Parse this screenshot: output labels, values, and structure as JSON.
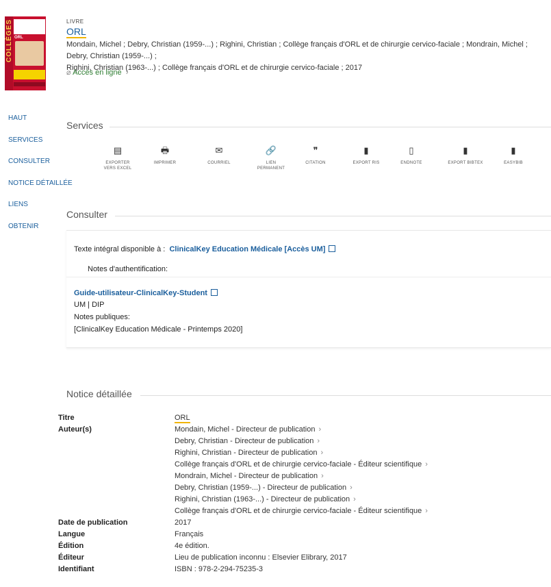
{
  "record": {
    "type": "LIVRE",
    "title": "ORL",
    "authors_line1": "Mondain, Michel ; Debry, Christian (1959-...) ; Righini, Christian ; Collège français d'ORL et de chirurgie cervico-faciale ; Mondrain, Michel ; Debry, Christian (1959-...) ;",
    "authors_line2": "Righini, Christian (1963-...) ; Collège français d'ORL et de chirurgie cervico-faciale ; 2017",
    "access": "Accès en ligne",
    "cover_text": "COLLÈGES",
    "cover_title": "ORL"
  },
  "nav": [
    "HAUT",
    "SERVICES",
    "CONSULTER",
    "NOTICE DÉTAILLÉE",
    "LIENS",
    "OBTENIR"
  ],
  "services": {
    "title": "Services",
    "items": [
      {
        "l1": "EXPORTER",
        "l2": "VERS EXCEL",
        "icon": "excel-icon",
        "glyph": "▤"
      },
      {
        "l1": "IMPRIMER",
        "l2": "",
        "icon": "print-icon",
        "glyph": "🖶"
      },
      {
        "l1": "COURRIEL",
        "l2": "",
        "icon": "mail-icon",
        "glyph": "✉"
      },
      {
        "l1": "LIEN",
        "l2": "PERMANENT",
        "icon": "link-icon",
        "glyph": "🔗"
      },
      {
        "l1": "CITATION",
        "l2": "",
        "icon": "quote-icon",
        "glyph": "❞"
      },
      {
        "l1": "EXPORT RIS",
        "l2": "",
        "icon": "file-icon",
        "glyph": "▮"
      },
      {
        "l1": "ENDNOTE",
        "l2": "",
        "icon": "file-outline-icon",
        "glyph": "▯"
      },
      {
        "l1": "EXPORT BIBTEX",
        "l2": "",
        "icon": "file-icon",
        "glyph": "▮"
      },
      {
        "l1": "EASYBIB",
        "l2": "",
        "icon": "file-icon",
        "glyph": "▮"
      }
    ]
  },
  "consulter": {
    "title": "Consulter",
    "fulltext_label": "Texte intégral disponible à :",
    "fulltext_link": "ClinicalKey Education Médicale [Accès UM]",
    "auth_notes": "Notes d'authentification:",
    "guide_link": "Guide-utilisateur-ClinicalKey-Student",
    "um_dip": "UM | DIP",
    "public_notes": "Notes publiques:",
    "public_value": "[ClinicalKey Education Médicale - Printemps 2020]"
  },
  "details": {
    "title": "Notice détaillée",
    "titre_label": "Titre",
    "titre_value": "ORL",
    "auteurs_label": "Auteur(s)",
    "auteurs": [
      "Mondain, Michel - Directeur de publication",
      "Debry, Christian - Directeur de publication",
      "Righini, Christian - Directeur de publication",
      "Collège français d'ORL et de chirurgie cervico-faciale - Éditeur scientifique",
      "Mondrain, Michel - Directeur de publication",
      "Debry, Christian (1959-...) - Directeur de publication",
      "Righini, Christian (1963-...) - Directeur de publication",
      "Collège français d'ORL et de chirurgie cervico-faciale - Éditeur scientifique"
    ],
    "fields": [
      {
        "label": "Date de publication",
        "value": "2017"
      },
      {
        "label": "Langue",
        "value": "Français"
      },
      {
        "label": "Édition",
        "value": "4e édition."
      },
      {
        "label": "Éditeur",
        "value": "Lieu de publication inconnu : Elsevier Elibrary, 2017"
      },
      {
        "label": "Identifiant",
        "value": "ISBN : 978-2-294-75235-3"
      }
    ]
  }
}
